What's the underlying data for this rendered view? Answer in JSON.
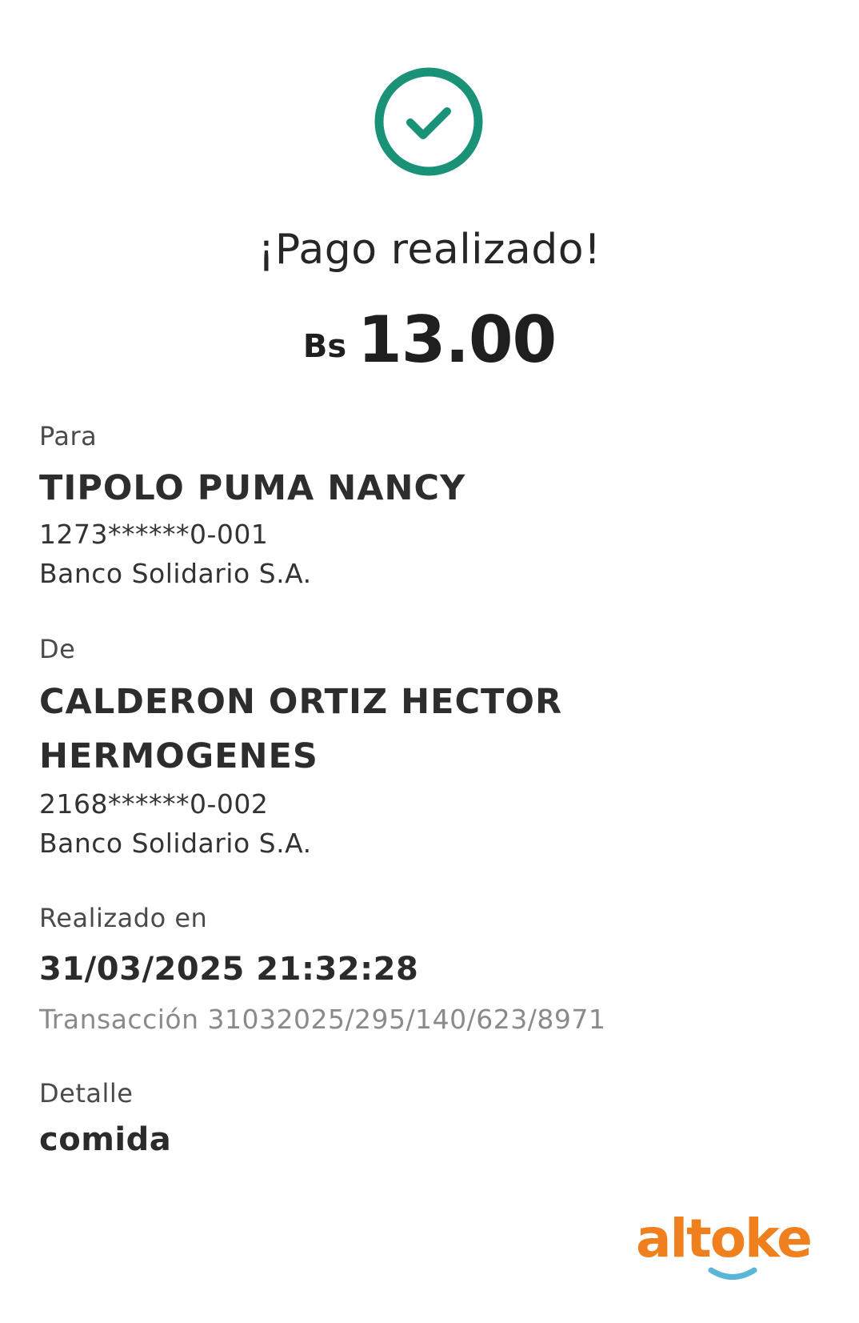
{
  "header": {
    "check_icon": "check-circle-icon",
    "check_color": "#1a9278",
    "title": "¡Pago realizado!",
    "currency": "Bs",
    "amount": "13.00"
  },
  "recipient": {
    "label": "Para",
    "name": "TIPOLO PUMA NANCY",
    "account": "1273******0-001",
    "bank": "Banco Solidario S.A."
  },
  "sender": {
    "label": "De",
    "name_line1": "CALDERON ORTIZ HECTOR",
    "name_line2": "HERMOGENES",
    "account": "2168******0-002",
    "bank": "Banco Solidario S.A."
  },
  "timestamp": {
    "label": "Realizado en",
    "value": "31/03/2025 21:32:28",
    "transaction": "Transacción 31032025/295/140/623/8971"
  },
  "detail": {
    "label": "Detalle",
    "value": "comida"
  },
  "brand": {
    "logo_text": "altoke",
    "logo_color": "#f07f1d",
    "smile_color": "#5ab6d8"
  }
}
